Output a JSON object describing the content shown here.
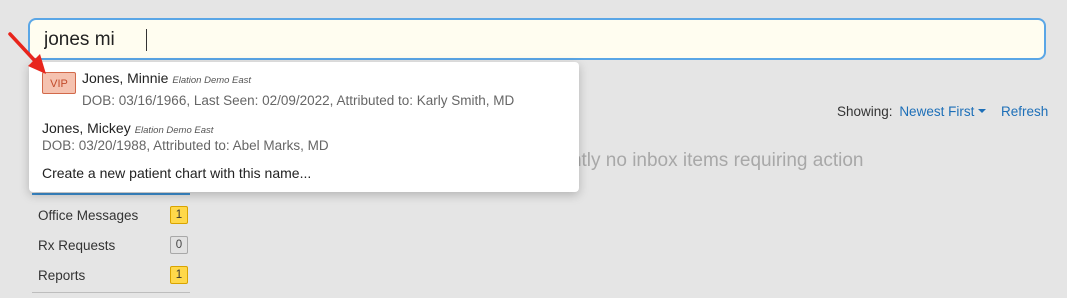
{
  "search": {
    "value": "jones mi"
  },
  "results": [
    {
      "badge": "VIP",
      "name": "Jones, Minnie",
      "practice": "Elation Demo East",
      "details": "DOB: 03/16/1966, Last Seen: 02/09/2022, Attributed to: Karly Smith, MD"
    },
    {
      "name": "Jones, Mickey",
      "practice": "Elation Demo East",
      "details": "DOB: 03/20/1988, Attributed to: Abel Marks, MD"
    }
  ],
  "create_new_label": "Create a new patient chart with this name...",
  "toolbar": {
    "showing_label": "Showing:",
    "showing_value": "Newest First",
    "refresh_label": "Refresh"
  },
  "empty_message": "There are currently no inbox items requiring action",
  "sidebar": {
    "items": [
      {
        "label": "Office Messages",
        "count": "1"
      },
      {
        "label": "Rx Requests",
        "count": "0"
      },
      {
        "label": "Reports",
        "count": "1"
      }
    ]
  },
  "colors": {
    "annotation_arrow": "#e8251c",
    "link": "#1d6fb8",
    "search_border": "#5aa6e6",
    "vip_badge_bg": "#f5c2b0",
    "count_alert_bg": "#ffd84a"
  }
}
